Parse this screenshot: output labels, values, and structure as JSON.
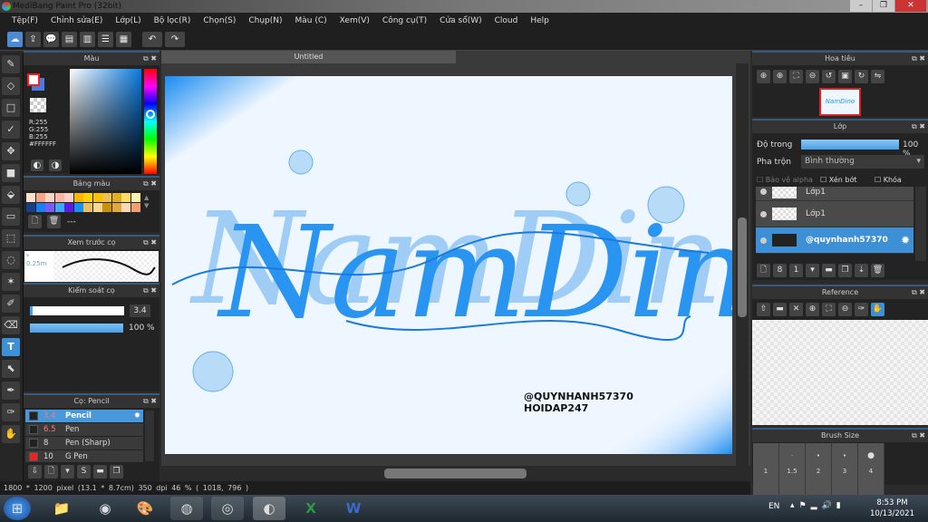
{
  "window": {
    "title": "MediBang Paint Pro (32bit)",
    "minimize": "–",
    "maximize": "❐",
    "close": "✕"
  },
  "menu": [
    "Tệp(F)",
    "Chỉnh sửa(E)",
    "Lớp(L)",
    "Bộ lọc(R)",
    "Chọn(S)",
    "Chụp(N)",
    "Màu (C)",
    "Xem(V)",
    "Công cụ(T)",
    "Cửa sổ(W)",
    "Cloud",
    "Help"
  ],
  "color_panel": {
    "title": "Màu",
    "r": "R:255",
    "g": "G:255",
    "b": "B:255",
    "hex": "#FFFFFF",
    "fg": "#ffffff",
    "bg": "#4a7be0"
  },
  "palette_panel": {
    "title": "Bảng màu",
    "name": "---",
    "colors": [
      "#fde0cc",
      "#f5a58a",
      "#f9d4c8",
      "#f7b7a0",
      "#fbd0c9",
      "#f6b800",
      "#fdd200",
      "#f8c200",
      "#efc24a",
      "#dfb020",
      "#fbdc6a",
      "#fff4b0",
      "#173f86",
      "#1b7ff0",
      "#7a5cf0",
      "#40a8f8",
      "#5a1ce0",
      "#1890f0",
      "#e8c060",
      "#f8d890",
      "#c8900f",
      "#e0a840",
      "#f8d8b8",
      "#f0a070"
    ]
  },
  "brush_preview": {
    "title": "Xem trước cọ",
    "size": "0.25m"
  },
  "brush_control": {
    "title": "Kiểm soát cọ",
    "size": "3.4",
    "opacity": "100 %",
    "opacity_fraction": 1.0
  },
  "brush_list": {
    "title": "Cọ: Pencil",
    "items": [
      {
        "size": "3.4",
        "name": "Pencil",
        "selected": true
      },
      {
        "size": "6.5",
        "name": "Pen"
      },
      {
        "size": "8",
        "name": "Pen (Sharp)"
      },
      {
        "size": "10",
        "name": "G Pen"
      }
    ]
  },
  "canvas": {
    "tab": "Untitled",
    "art_title": "NamDino",
    "sig1": "@QUYNHANH57370",
    "sig2": "HOIDAP247"
  },
  "status": {
    "size": "1800 * 1200 pixel",
    "cm": "(13.1 * 8.7cm)",
    "dpi": "350 dpi",
    "zoom": "46 %",
    "coords": "( 1018, 796 )"
  },
  "navigator": {
    "title": "Hoa tiêu"
  },
  "layers": {
    "title": "Lớp",
    "opacity_label": "Độ trong",
    "opacity": "100 %",
    "opacity_fraction": 1.0,
    "blend_label": "Pha trộn",
    "blend": "Bình thường",
    "protect_alpha": "Bảo vệ alpha",
    "clip": "Xén bớt",
    "lock": "Khóa",
    "items": [
      {
        "name": "Lớp1"
      },
      {
        "name": "Lớp1"
      },
      {
        "name": "@quynhanh57370",
        "selected": true
      }
    ]
  },
  "reference": {
    "title": "Reference"
  },
  "brush_size": {
    "title": "Brush Size",
    "sizes": [
      "1",
      "1.5",
      "2",
      "3",
      "4"
    ]
  },
  "taskbar": {
    "lang": "EN",
    "time": "8:53 PM",
    "date": "10/13/2021"
  }
}
